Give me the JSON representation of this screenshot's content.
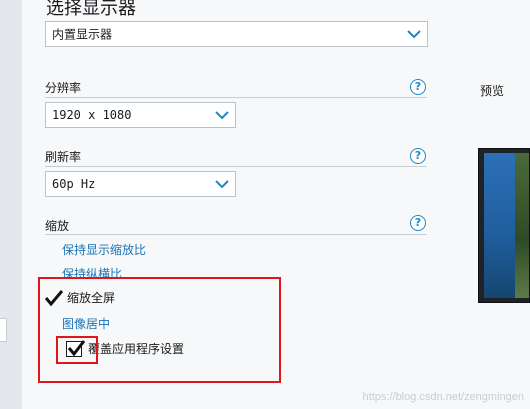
{
  "display": {
    "section_title": "选择显示器",
    "monitor_select": "内置显示器"
  },
  "resolution": {
    "label": "分辨率",
    "value": "1920 x 1080"
  },
  "refresh": {
    "label": "刷新率",
    "value": "60p Hz"
  },
  "scaling": {
    "label": "缩放",
    "options": [
      {
        "label": "保持显示缩放比"
      },
      {
        "label": "保持纵横比"
      },
      {
        "label": "缩放全屏",
        "selected": true
      },
      {
        "label": "图像居中"
      }
    ],
    "override_label": "覆盖应用程序设置",
    "override_checked": true
  },
  "preview": {
    "label": "预览"
  },
  "watermark": "https://blog.csdn.net/zengmingen",
  "help_glyph": "?",
  "icons": {
    "chevron": "chevron-down-icon",
    "help": "help-icon",
    "check": "checkmark-icon"
  },
  "colors": {
    "accent": "#1e88c7",
    "link": "#1a73b4",
    "annotation": "#e0161d"
  }
}
